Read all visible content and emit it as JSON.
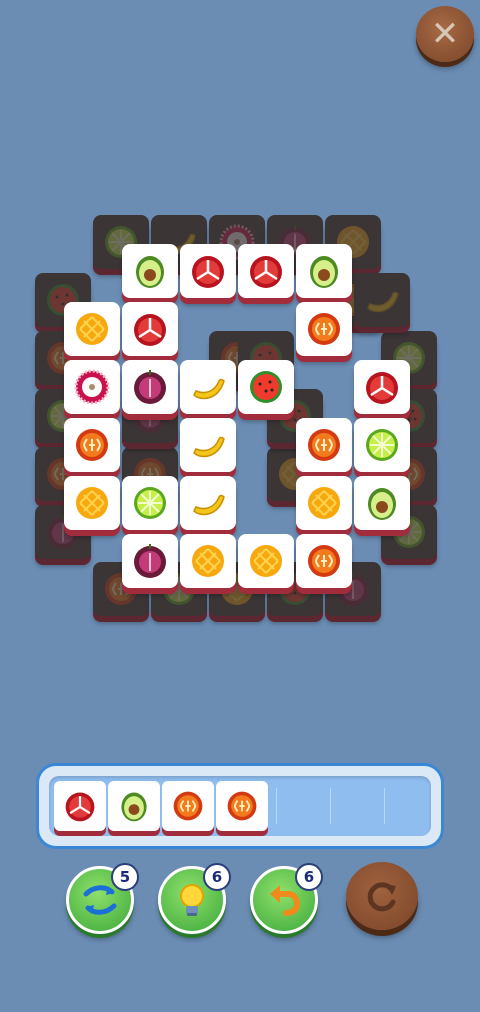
{
  "top": {
    "close_icon": "close-x-icon"
  },
  "board": {
    "top_layer": [
      [
        "avocado",
        "pomegranate",
        "pomegranate",
        "avocado",
        null
      ],
      [
        "mango",
        "pomegranate",
        null,
        "orange",
        null
      ],
      [
        "mangosteen-white",
        "plum",
        "banana",
        "watermelon",
        "pomegranate"
      ],
      [
        "orange",
        null,
        "banana",
        "orange",
        "lime"
      ],
      [
        "mango",
        "lime",
        "banana",
        "mango",
        "avocado"
      ],
      [
        null,
        "plum",
        "mango",
        "mango",
        "orange"
      ]
    ]
  },
  "tray": {
    "slots": [
      "pomegranate",
      "avocado",
      "orange",
      "orange"
    ],
    "capacity": 7
  },
  "powerups": [
    {
      "name": "shuffle",
      "icon": "shuffle-icon",
      "count": "5"
    },
    {
      "name": "hint",
      "icon": "bulb-icon",
      "count": "6"
    },
    {
      "name": "undo",
      "icon": "undo-icon",
      "count": "6"
    }
  ],
  "restart": {
    "icon": "restart-icon"
  },
  "colors": {
    "background": "#6b8db4",
    "tile_edge": "#a12d3c",
    "tray_border": "#3a87d6",
    "power_green": "#3ba83a"
  }
}
